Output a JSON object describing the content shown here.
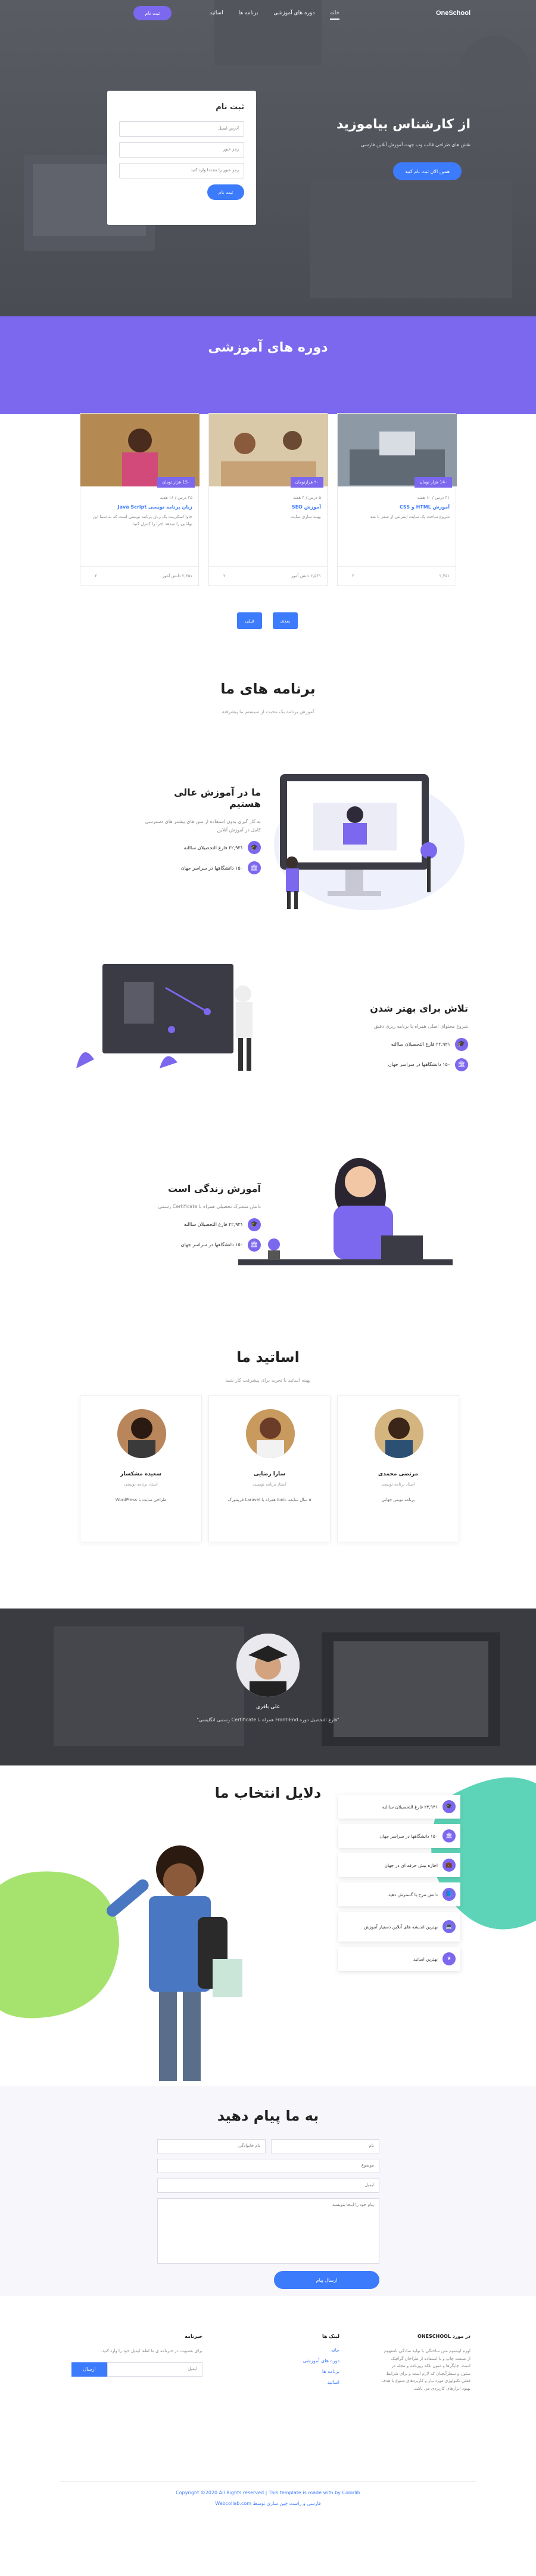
{
  "nav": {
    "brand": "OneSchool",
    "links": [
      "خانه",
      "دوره های آموزشی",
      "برنامه ها",
      "اساتید"
    ],
    "cta": "ثبت نام"
  },
  "hero": {
    "title": "از کارشناس بیاموزید",
    "subtitle": "نقش های طراحی قالب وب جهت آموزش آنلاین فارسی",
    "button": "همین الان ثبت نام کنید"
  },
  "signup": {
    "title": "ثبت نام",
    "fields": [
      "آدرس ایمیل",
      "رمز عبور",
      "رمز عبور را مجددا وارد کنید"
    ],
    "button": "ثبت نام"
  },
  "courses": {
    "title": "دوره های آموزشی",
    "items": [
      {
        "price": "14۰ هزار تومان",
        "meta": "۳۱ درس / ۱۰ هفته",
        "title": "آموزش HTML و CSS",
        "desc": "شروع ساخت یک سایت اینترنتی از صفر تا صد",
        "students": "۲,۴۵۱",
        "rating": "۳"
      },
      {
        "price": "۹۰ هزارتومان",
        "meta": "۵ درس / ۴ هفته",
        "title": "آموزش SEO",
        "desc": "بهینه سازی سایت",
        "students": "۲,۵۴۱ دانش آموز",
        "rating": "۲"
      },
      {
        "price": "15۰ هزار تومان",
        "meta": "۲۵ درس / ۱۶ هفته",
        "title": "زبان برنامه نویسی Java Script",
        "desc": "جاوا اسکریپت یک زبان برنامه نویسی است که به شما این توانایی را میدهد اجزا را کنترل کنید.",
        "students": "۲,۴۵۱ دانش آموز",
        "rating": "۳"
      }
    ],
    "prev": "قبلی",
    "next": "بعدی"
  },
  "programs": {
    "title": "برنامه های ما",
    "subtitle": "آموزش برنامه یک محبت از سیستم ما پیشرفته",
    "features": [
      {
        "title": "ما در آموزش عالی هستیم",
        "desc": "به کار گیری بدون استفاده از متن های بیشتر های دسترسی کامل در آموزش آنلاین",
        "stats": [
          "۲۲,۹۳۱ فارغ التحصیلان ساالنه",
          "۱۵۰ دانشگاهها در سراسر جهان"
        ]
      },
      {
        "title": "تلاش برای بهتر شدن",
        "desc": "شروع محتوای اصلی همراه با برنامه ریزی دقیق",
        "stats": [
          "۲۲,۹۳۱ فارغ التحصیلان ساالنه",
          "۱۵۰ دانشگاهها در سراسر جهان"
        ]
      },
      {
        "title": "آموزش زندگی است",
        "desc": "دانش مشترک تحصیلی همراه با Certificate رسمی",
        "stats": [
          "۲۲,۹۳۱ فارغ التحصیلان ساالنه",
          "۱۵۰ دانشگاهها در سراسر جهان"
        ]
      }
    ]
  },
  "teachers": {
    "title": "اساتید ما",
    "subtitle": "بهینه اساتید با تجربه برای پیشرفت کار شما",
    "items": [
      {
        "name": "مرتضی محمدی",
        "role": "استاد برنامه نویسی",
        "bio": "برنامه نویس جهانی"
      },
      {
        "name": "سارا رضایی",
        "role": "استاد برنامه نویسی",
        "bio": "۵ سال سابقه Ionic همراه با Laravel فریمورک"
      },
      {
        "name": "سعیده مشکسار",
        "role": "استاد برنامه نویسی",
        "bio": "طراحی سایت با WordPress"
      }
    ]
  },
  "testimonial": {
    "name": "علی باقری",
    "quote": "\"فارغ التحصیل دوره Front-End همراه با Certificate رسمی انگلیسی\""
  },
  "why": {
    "title": "دلایل انتخاب ما",
    "items": [
      "۲۲,۹۳۱ فارغ التحصیلان ساالنه",
      "۱۵۰ دانشگاهها در سراسر جهان",
      "اجازه بیش حرفه ای در جهان",
      "دانش مرح با گسترش دهید",
      "بهترین اندیشه های آنلاین دستیار آموزش",
      "بهترین اساتید"
    ]
  },
  "contact": {
    "title": "به ما پیام دهید",
    "name_ph": "نام",
    "family_ph": "نام خانوادگی",
    "subject_ph": "موضوع",
    "email_ph": "ایمیل",
    "message_ph": "پیام خود را اینجا بنویسید",
    "button": "ارسال پیام"
  },
  "footer": {
    "about_title": "در مورد ONESCHOOL",
    "about_text": "لورم ایپسوم متن ساختگی با تولید سادگی نامفهوم از صنعت چاپ و با استفاده از طراحان گرافیک است. چاپگرها و متون بلکه روزنامه و مجله در ستون و سطرآنچنان که لازم است و برای شرایط فعلی تکنولوژی مورد نیاز و کاربردهای متنوع با هدف بهبود ابزارهای کاربردی می باشد.",
    "links_title": "لینک ها",
    "links": [
      "خانه",
      "دوره های آموزشی",
      "برنامه ها",
      "اساتید"
    ],
    "news_title": "خبرنامه",
    "news_text": "برای عضویت در خبرنامه ی ما لطفا ایمیل خود را وارد کنید.",
    "news_ph": "ایمیل",
    "news_button": "ارسال",
    "copyright": "Copyright ©2020 All Rights reserved | This template is made with by Colorlib",
    "credit": "فارسی و راست چین سازی توسط Webcollab.com"
  }
}
